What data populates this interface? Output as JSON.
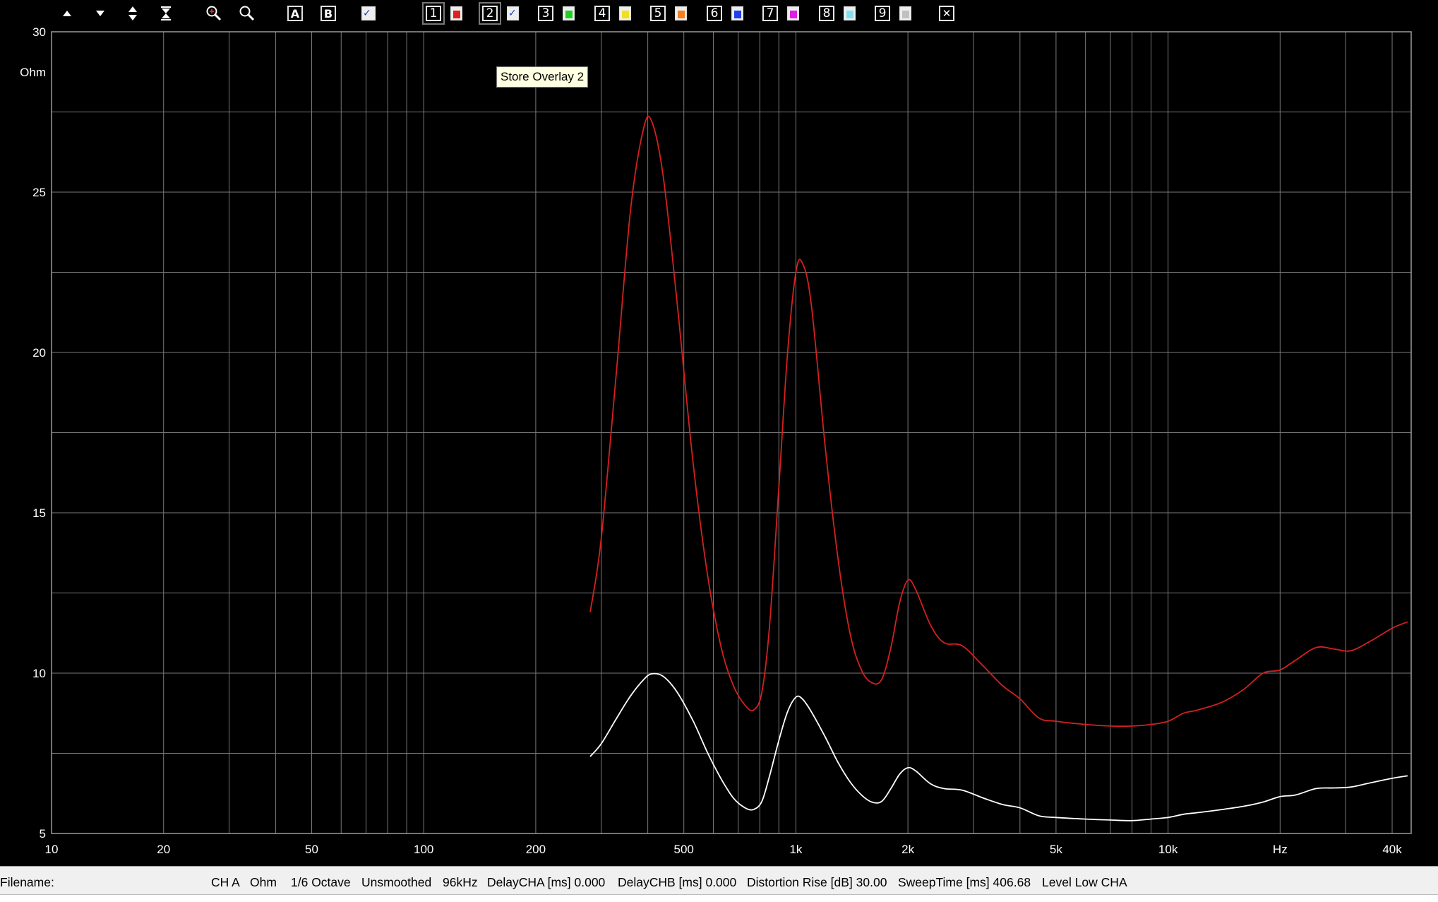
{
  "toolbar": {
    "overlays": [
      {
        "num": "1",
        "color": "#e02020"
      },
      {
        "num": "2",
        "color": "#ffffff",
        "checked": true
      },
      {
        "num": "3",
        "color": "#22cc22"
      },
      {
        "num": "4",
        "color": "#f0e020"
      },
      {
        "num": "5",
        "color": "#f08020"
      },
      {
        "num": "6",
        "color": "#2040f0"
      },
      {
        "num": "7",
        "color": "#e020e0"
      },
      {
        "num": "8",
        "color": "#80e0f0"
      },
      {
        "num": "9",
        "color": "#c0c0c0"
      }
    ],
    "btn_a": "A",
    "btn_b": "B",
    "tooltip": "Store Overlay 2"
  },
  "colors": {
    "background": "#000000",
    "grid": "#7a7a7a",
    "axis_text": "#ffffff"
  },
  "chart_data": {
    "type": "line",
    "x_scale": "log",
    "xlim": [
      10,
      45000
    ],
    "ylim": [
      5,
      30
    ],
    "grid": true,
    "xlabel": "Hz",
    "ylabel": "Ohm",
    "xticks": [
      {
        "v": 10,
        "label": "10"
      },
      {
        "v": 20,
        "label": "20"
      },
      {
        "v": 50,
        "label": "50"
      },
      {
        "v": 100,
        "label": "100"
      },
      {
        "v": 200,
        "label": "200"
      },
      {
        "v": 500,
        "label": "500"
      },
      {
        "v": 1000,
        "label": "1k"
      },
      {
        "v": 2000,
        "label": "2k"
      },
      {
        "v": 5000,
        "label": "5k"
      },
      {
        "v": 10000,
        "label": "10k"
      },
      {
        "v": 40000,
        "label": "40k"
      }
    ],
    "yticks": [
      {
        "v": 5,
        "label": "5"
      },
      {
        "v": 10,
        "label": "10"
      },
      {
        "v": 15,
        "label": "15"
      },
      {
        "v": 20,
        "label": "20"
      },
      {
        "v": 25,
        "label": "25"
      },
      {
        "v": 30,
        "label": "30"
      }
    ],
    "series": [
      {
        "color": "#d42020",
        "points": [
          [
            280,
            11.9
          ],
          [
            300,
            14.2
          ],
          [
            330,
            19.5
          ],
          [
            360,
            24.5
          ],
          [
            390,
            27.0
          ],
          [
            410,
            27.2
          ],
          [
            440,
            25.5
          ],
          [
            480,
            21.5
          ],
          [
            530,
            16.5
          ],
          [
            580,
            13.0
          ],
          [
            630,
            10.8
          ],
          [
            680,
            9.6
          ],
          [
            730,
            9.0
          ],
          [
            770,
            8.85
          ],
          [
            810,
            9.4
          ],
          [
            850,
            11.5
          ],
          [
            900,
            15.8
          ],
          [
            950,
            20.0
          ],
          [
            1000,
            22.5
          ],
          [
            1040,
            22.8
          ],
          [
            1100,
            21.5
          ],
          [
            1200,
            17.0
          ],
          [
            1300,
            13.5
          ],
          [
            1400,
            11.2
          ],
          [
            1500,
            10.1
          ],
          [
            1600,
            9.7
          ],
          [
            1700,
            9.8
          ],
          [
            1800,
            10.8
          ],
          [
            1900,
            12.2
          ],
          [
            2000,
            12.9
          ],
          [
            2100,
            12.6
          ],
          [
            2300,
            11.5
          ],
          [
            2500,
            10.95
          ],
          [
            2800,
            10.85
          ],
          [
            3200,
            10.2
          ],
          [
            3600,
            9.6
          ],
          [
            4000,
            9.2
          ],
          [
            4500,
            8.6
          ],
          [
            5000,
            8.5
          ],
          [
            6000,
            8.4
          ],
          [
            7000,
            8.35
          ],
          [
            8000,
            8.35
          ],
          [
            9000,
            8.4
          ],
          [
            10000,
            8.5
          ],
          [
            11000,
            8.75
          ],
          [
            12000,
            8.85
          ],
          [
            14000,
            9.1
          ],
          [
            16000,
            9.5
          ],
          [
            18000,
            10.0
          ],
          [
            20000,
            10.1
          ],
          [
            22000,
            10.4
          ],
          [
            25000,
            10.8
          ],
          [
            28000,
            10.75
          ],
          [
            31000,
            10.7
          ],
          [
            35000,
            11.0
          ],
          [
            40000,
            11.4
          ],
          [
            44000,
            11.6
          ]
        ]
      },
      {
        "color": "#ffffff",
        "points": [
          [
            280,
            7.4
          ],
          [
            300,
            7.8
          ],
          [
            330,
            8.6
          ],
          [
            360,
            9.3
          ],
          [
            390,
            9.8
          ],
          [
            410,
            9.98
          ],
          [
            440,
            9.9
          ],
          [
            480,
            9.4
          ],
          [
            530,
            8.5
          ],
          [
            580,
            7.5
          ],
          [
            630,
            6.7
          ],
          [
            680,
            6.1
          ],
          [
            730,
            5.8
          ],
          [
            770,
            5.75
          ],
          [
            810,
            6.0
          ],
          [
            850,
            6.8
          ],
          [
            900,
            7.9
          ],
          [
            950,
            8.8
          ],
          [
            1000,
            9.25
          ],
          [
            1040,
            9.2
          ],
          [
            1100,
            8.8
          ],
          [
            1200,
            8.0
          ],
          [
            1300,
            7.2
          ],
          [
            1400,
            6.6
          ],
          [
            1500,
            6.2
          ],
          [
            1600,
            5.98
          ],
          [
            1700,
            6.0
          ],
          [
            1800,
            6.4
          ],
          [
            1900,
            6.85
          ],
          [
            2000,
            7.05
          ],
          [
            2100,
            6.95
          ],
          [
            2300,
            6.55
          ],
          [
            2500,
            6.4
          ],
          [
            2800,
            6.35
          ],
          [
            3200,
            6.1
          ],
          [
            3600,
            5.9
          ],
          [
            4000,
            5.8
          ],
          [
            4500,
            5.55
          ],
          [
            5000,
            5.5
          ],
          [
            6000,
            5.45
          ],
          [
            7000,
            5.42
          ],
          [
            8000,
            5.4
          ],
          [
            9000,
            5.45
          ],
          [
            10000,
            5.5
          ],
          [
            11000,
            5.6
          ],
          [
            12000,
            5.65
          ],
          [
            14000,
            5.75
          ],
          [
            16000,
            5.85
          ],
          [
            18000,
            5.98
          ],
          [
            20000,
            6.15
          ],
          [
            22000,
            6.2
          ],
          [
            25000,
            6.4
          ],
          [
            28000,
            6.42
          ],
          [
            31000,
            6.45
          ],
          [
            35000,
            6.58
          ],
          [
            40000,
            6.72
          ],
          [
            44000,
            6.8
          ]
        ]
      }
    ]
  },
  "status": {
    "filename_label": "Filename:",
    "items": [
      "CH A",
      "Ohm",
      "1/6 Octave",
      "Unsmoothed",
      "96kHz",
      "DelayCHA [ms] 0.000",
      "DelayCHB [ms] 0.000",
      "Distortion Rise [dB] 30.00",
      "SweepTime [ms] 406.68",
      "Level Low CHA"
    ]
  }
}
